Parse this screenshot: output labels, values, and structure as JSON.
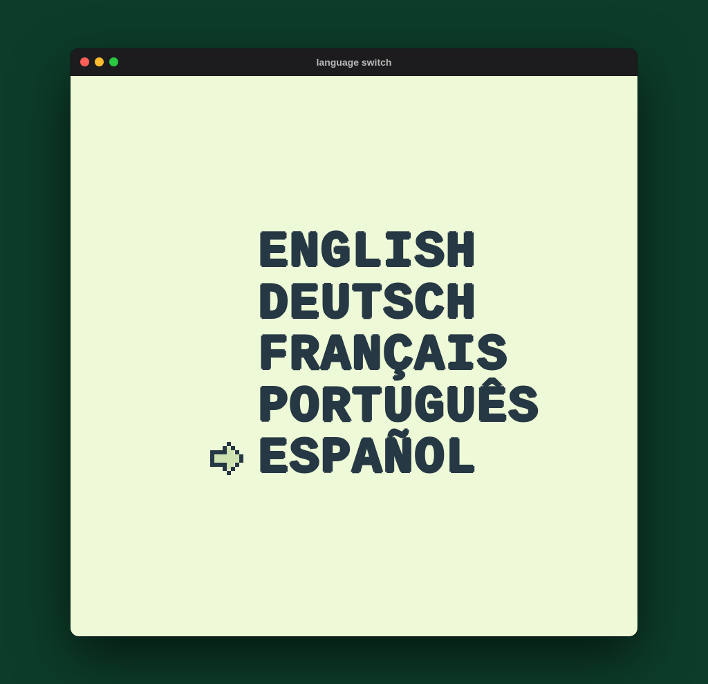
{
  "window": {
    "title": "language switch",
    "traffic_lights": {
      "close_color": "#ff5f57",
      "minimize_color": "#febc2e",
      "zoom_color": "#28c840"
    },
    "content_bg": "#eefad7"
  },
  "menu": {
    "selected_index": 4,
    "items": [
      {
        "label": "ENGLISH"
      },
      {
        "label": "DEUTSCH"
      },
      {
        "label": "FRANÇAIS"
      },
      {
        "label": "PORTUGUÊS"
      },
      {
        "label": "ESPAÑOL"
      }
    ],
    "cursor_icon": "arrow-right-icon"
  },
  "colors": {
    "text": "#263844",
    "arrow_fill": "#cfe2b1",
    "arrow_stroke": "#263844"
  }
}
